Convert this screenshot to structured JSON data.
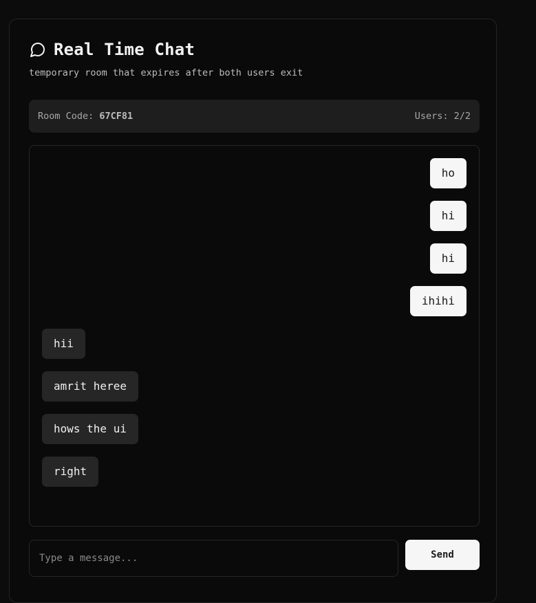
{
  "header": {
    "icon": "chat-bubble-icon",
    "title": "Real Time Chat",
    "subtitle": "temporary room that expires after both users exit"
  },
  "room": {
    "code_label": "Room Code:",
    "code": "67CF81",
    "users_label": "Users:",
    "users": "2/2"
  },
  "messages": [
    {
      "text": "ho",
      "direction": "out"
    },
    {
      "text": "hi",
      "direction": "out"
    },
    {
      "text": "hi",
      "direction": "out"
    },
    {
      "text": "ihihi",
      "direction": "out"
    },
    {
      "text": "hii",
      "direction": "in"
    },
    {
      "text": "amrit heree",
      "direction": "in"
    },
    {
      "text": "hows the ui",
      "direction": "in"
    },
    {
      "text": "right",
      "direction": "in"
    }
  ],
  "composer": {
    "placeholder": "Type a message...",
    "value": "",
    "send_label": "Send"
  },
  "colors": {
    "background": "#0c0c0c",
    "outgoing_bubble": "#f6f6f6",
    "incoming_bubble": "#262626",
    "room_bar": "#1e1e1e"
  }
}
